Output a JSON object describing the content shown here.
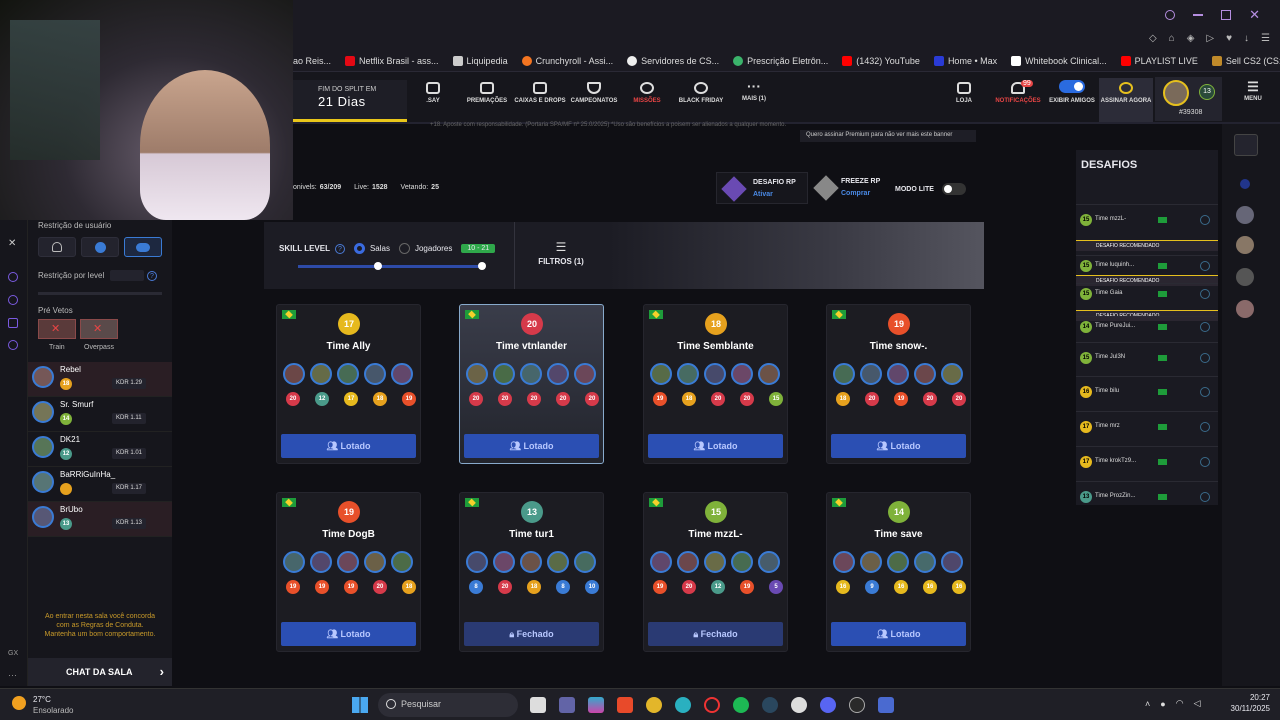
{
  "browser": {
    "bookmarks": [
      "ao Reis...",
      "Netflix Brasil - ass...",
      "Liquipedia",
      "Crunchyroll - Assi...",
      "Servidores de CS...",
      "Prescrição Eletrôn...",
      "(1432) YouTube",
      "Home • Max",
      "Whitebook Clinical...",
      "PLAYLIST LIVE",
      "Sell CS2 (CS:GO)..."
    ]
  },
  "nav": {
    "split_label": "FIM DO SPLIT EM",
    "split_value": "21 Dias",
    "items": [
      {
        "label": ".SAY",
        "red": false
      },
      {
        "label": "PREMIAÇÕES",
        "red": false
      },
      {
        "label": "CAIXAS E DROPS",
        "red": false
      },
      {
        "label": "CAMPEONATOS",
        "red": false
      },
      {
        "label": "MISSÕES",
        "red": true
      },
      {
        "label": "BLACK FRIDAY",
        "red": false
      },
      {
        "label": "MAIS (1)",
        "red": false
      }
    ],
    "right": [
      {
        "label": "LOJA",
        "red": false
      },
      {
        "label": "NOTIFICAÇÕES",
        "red": true
      },
      {
        "label": "EXIBIR AMIGOS",
        "red": false
      },
      {
        "label": "ASSINAR AGORA",
        "red": false
      }
    ],
    "notif_count": "99",
    "profile_level": "13",
    "profile_id": "#39308",
    "menu_label": "MENU",
    "premium_notice": "Quero assinar Premium para não ver mais este banner",
    "legal_notice": "+18. Aposte com responsabilidade. (Portaria SPA/MF nº 25.0/2025) *Uso são benefícios a poisem ser alienados a qualquer momento."
  },
  "lobby": {
    "stats": {
      "label1": "onivels:",
      "v1": "63/209",
      "label2": "Live:",
      "v2": "1528",
      "label3": "Vetando:",
      "v3": "25"
    },
    "desafio_rp": "DESAFIO RP",
    "desafio_rp_action": "Ativar",
    "freeze_rp": "FREEZE RP",
    "freeze_rp_action": "Comprar",
    "modo_lite": "MODO LITE",
    "skill_level": "SKILL LEVEL",
    "salas": "Salas",
    "jogadores": "Jogadores",
    "range": "10 - 21",
    "filtros": "FILTROS (1)"
  },
  "left": {
    "restr_user": "Restrição de usuário",
    "restr_level": "Restrição por level",
    "pre_vetos": "Pré Vetos",
    "vetos": [
      "Train",
      "Overpass"
    ],
    "players": [
      {
        "name": "Rebel",
        "lvl": "18",
        "kdr": "KDR 1.29",
        "color": "#e6a11e"
      },
      {
        "name": "Sr. Smurf",
        "lvl": "14",
        "kdr": "KDR 1.11",
        "color": "#7fb23a"
      },
      {
        "name": "DK21",
        "lvl": "12",
        "kdr": "KDR 1.01",
        "color": "#4a9a8a"
      },
      {
        "name": "BaRRiGuInHa_",
        "lvl": "",
        "kdr": "KDR 1.17",
        "color": "#e6a11e"
      },
      {
        "name": "BrUbo",
        "lvl": "13",
        "kdr": "KDR 1.13",
        "color": "#4a9a8a"
      }
    ],
    "rules_text": "Ao entrar nesta sala você concorda com as Regras de Conduta. Mantenha um bom comportamento.",
    "chat": "CHAT DA SALA",
    "gx": "GX"
  },
  "rooms": [
    {
      "name": "Time Ally",
      "lvl": "17",
      "lvlColor": "#e6b91e",
      "lvls": [
        "20",
        "12",
        "17",
        "18",
        "19"
      ],
      "btn": "Lotado",
      "closed": false
    },
    {
      "name": "Time vtnlander",
      "lvl": "20",
      "lvlColor": "#d63a4a",
      "lvls": [
        "20",
        "20",
        "20",
        "20",
        "20"
      ],
      "btn": "Lotado",
      "closed": false
    },
    {
      "name": "Time Semblante",
      "lvl": "18",
      "lvlColor": "#e6a11e",
      "lvls": [
        "19",
        "18",
        "20",
        "20",
        "15"
      ],
      "btn": "Lotado",
      "closed": false
    },
    {
      "name": "Time snow-.",
      "lvl": "19",
      "lvlColor": "#e8502a",
      "lvls": [
        "18",
        "20",
        "19",
        "20",
        "20"
      ],
      "btn": "Lotado",
      "closed": false
    },
    {
      "name": "Time DogB",
      "lvl": "19",
      "lvlColor": "#e8502a",
      "lvls": [
        "19",
        "19",
        "19",
        "20",
        "18"
      ],
      "btn": "Lotado",
      "closed": false
    },
    {
      "name": "Time tur1",
      "lvl": "13",
      "lvlColor": "#4a9a8a",
      "lvls": [
        "8",
        "20",
        "18",
        "8",
        "10"
      ],
      "btn": "Fechado",
      "closed": true
    },
    {
      "name": "Time mzzL-",
      "lvl": "15",
      "lvlColor": "#7fb23a",
      "lvls": [
        "19",
        "20",
        "12",
        "19",
        "5"
      ],
      "btn": "Fechado",
      "closed": true
    },
    {
      "name": "Time save",
      "lvl": "14",
      "lvlColor": "#7fb23a",
      "lvls": [
        "16",
        "9",
        "16",
        "16",
        "16"
      ],
      "btn": "Lotado",
      "closed": false
    }
  ],
  "desafios": {
    "title": "DESAFIOS",
    "recommended": "DESAFIO RECOMENDADO",
    "items": [
      {
        "name": "Time mzzL-",
        "lvl": "15"
      },
      {
        "name": "Time luquinh...",
        "lvl": "15"
      },
      {
        "name": "Time Gaia",
        "lvl": "15"
      },
      {
        "name": "Time PureJui...",
        "lvl": "14"
      },
      {
        "name": "Time Jul3N",
        "lvl": "15"
      },
      {
        "name": "Time bilu",
        "lvl": "16"
      },
      {
        "name": "Time mrz",
        "lvl": "17"
      },
      {
        "name": "Time krokTz9...",
        "lvl": "17"
      },
      {
        "name": "Time ProzZin...",
        "lvl": "13"
      }
    ]
  },
  "taskbar": {
    "temp": "27°C",
    "weather": "Ensolarado",
    "search": "Pesquisar",
    "time": "20:27",
    "date": "30/11/2025"
  }
}
